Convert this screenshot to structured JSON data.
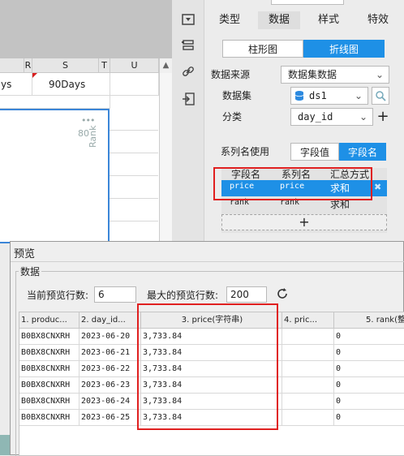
{
  "sheet": {
    "columns": [
      "R",
      "S",
      "T",
      "U"
    ],
    "row1": {
      "left_value": "ys",
      "s_value": "90Days"
    },
    "chart": {
      "y_tick": "80",
      "axis_label": "Rank",
      "more": "•••"
    }
  },
  "panel": {
    "tabs": [
      "类型",
      "数据",
      "样式",
      "特效"
    ],
    "active_tab": "数据",
    "chart_types": [
      "柱形图",
      "折线图"
    ],
    "active_chart_type": "折线图",
    "data_source_label": "数据来源",
    "data_source_value": "数据集数据",
    "dataset_label": "数据集",
    "dataset_value": "ds1",
    "category_label": "分类",
    "category_value": "day_id",
    "series_name_label": "系列名使用",
    "series_modes": [
      "字段值",
      "字段名"
    ],
    "active_series_mode": "字段名",
    "series_table": {
      "headers": [
        "字段名",
        "系列名",
        "汇总方式"
      ],
      "rows": [
        {
          "field": "price",
          "series": "price",
          "agg": "求和"
        },
        {
          "field": "rank",
          "series": "rank",
          "agg": "求和"
        }
      ]
    },
    "add_label": "+"
  },
  "preview": {
    "title": "预览",
    "group_label": "数据",
    "current_rows_label": "当前预览行数:",
    "current_rows_value": "6",
    "max_rows_label": "最大的预览行数:",
    "max_rows_value": "200",
    "columns": [
      "1. produc...",
      "2. day_id...",
      "3. price(字符串)",
      "4. pric...",
      "5. rank(整"
    ],
    "rows": [
      [
        "B0BX8CNXRH",
        "2023-06-20",
        "3,733.84",
        "",
        "0"
      ],
      [
        "B0BX8CNXRH",
        "2023-06-21",
        "3,733.84",
        "",
        "0"
      ],
      [
        "B0BX8CNXRH",
        "2023-06-22",
        "3,733.84",
        "",
        "0"
      ],
      [
        "B0BX8CNXRH",
        "2023-06-23",
        "3,733.84",
        "",
        "0"
      ],
      [
        "B0BX8CNXRH",
        "2023-06-24",
        "3,733.84",
        "",
        "0"
      ],
      [
        "B0BX8CNXRH",
        "2023-06-25",
        "3,733.84",
        "",
        "0"
      ]
    ]
  },
  "colors": {
    "accent": "#1e90e6",
    "highlight": "#e02020",
    "chart_border": "#3b86d8"
  }
}
